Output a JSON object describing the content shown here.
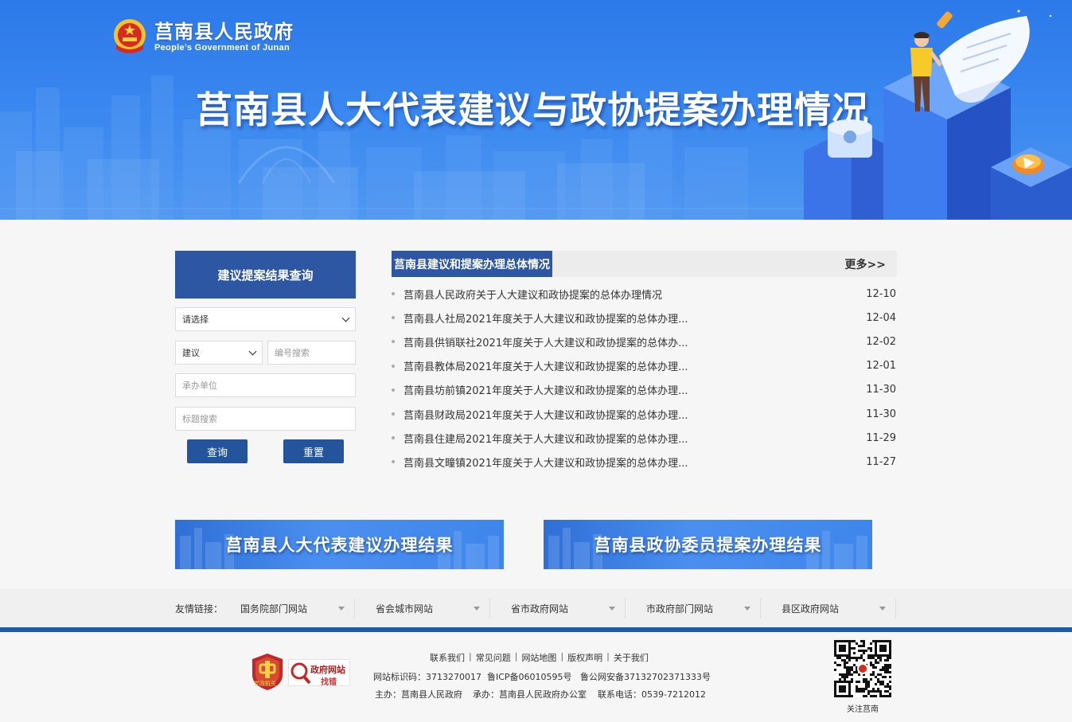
{
  "header": {
    "logo_cn": "莒南县人民政府",
    "logo_en": "People’s Government of Junan",
    "banner_title": "莒南县人大代表建议与政协提案办理情况"
  },
  "query": {
    "title": "建议提案结果查询",
    "select_default": "请选择",
    "type_select": "建议",
    "number_placeholder": "编号搜索",
    "unit_placeholder": "承办单位",
    "title_placeholder": "标题搜索",
    "search_label": "查询",
    "reset_label": "重置"
  },
  "news": {
    "heading": "莒南县建议和提案办理总体情况",
    "more": "更多>>",
    "items": [
      {
        "title": "莒南县人民政府关于人大建议和政协提案的总体办理情况",
        "date": "12-10"
      },
      {
        "title": "莒南县人社局2021年度关于人大建议和政协提案的总体办理...",
        "date": "12-04"
      },
      {
        "title": "莒南县供销联社2021年度关于人大建议和政协提案的总体办...",
        "date": "12-02"
      },
      {
        "title": "莒南县教体局2021年度关于人大建议和政协提案的总体办理...",
        "date": "12-01"
      },
      {
        "title": "莒南县坊前镇2021年度关于人大建议和政协提案的总体办理...",
        "date": "11-30"
      },
      {
        "title": "莒南县财政局2021年度关于人大建议和政协提案的总体办理...",
        "date": "11-30"
      },
      {
        "title": "莒南县住建局2021年度关于人大建议和政协提案的总体办理...",
        "date": "11-29"
      },
      {
        "title": "莒南县文疃镇2021年度关于人大建议和政协提案的总体办理...",
        "date": "11-27"
      }
    ]
  },
  "results": {
    "npc": "莒南县人大代表建议办理结果",
    "cppcc": "莒南县政协委员提案办理结果"
  },
  "links": {
    "label": "友情链接：",
    "items": [
      "国务院部门网站",
      "省会城市网站",
      "省市政府网站",
      "市政府部门网站",
      "县区政府网站"
    ]
  },
  "footer": {
    "nav": [
      "联系我们",
      "常见问题",
      "网站地图",
      "版权声明",
      "关于我们"
    ],
    "site_id": "网站标识码：3713270017",
    "icp": "鲁ICP备06010595号",
    "police": "鲁公网安备37132702371333号",
    "host": "主办：莒南县人民政府",
    "operator": "承办：莒南县人民政府办公室",
    "phone": "联系电话：0539-7212012",
    "badge_party_text": "党政机关",
    "badge_error_line1": "政府网站",
    "badge_error_line2": "找错",
    "qr_label": "关注莒南"
  },
  "colors": {
    "primary": "#2d56a3",
    "button": "#24549c",
    "footer_line": "#1d5aa8",
    "banner_blue": "#3b89f0"
  }
}
